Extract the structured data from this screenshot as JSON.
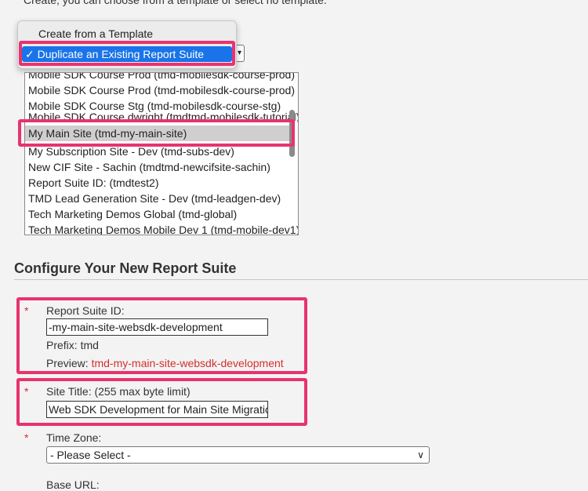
{
  "intro_text": "Create, you can choose from a template or select no template.",
  "template_menu": {
    "options": [
      "Create from a Template",
      "Duplicate an Existing Report Suite"
    ],
    "selected_index": 1,
    "checkmark": "✓"
  },
  "report_suite_list": {
    "items": [
      "Mobile SDK Course Prod (tmd-mobilesdk-course-prod)",
      "Mobile SDK Course Stg (tmd-mobilesdk-course-stg)",
      "Mobile SDK Course dwright (tmdtmd-mobilesdk-tutorial)",
      "My Main Site (tmd-my-main-site)",
      "My Subscription Site - Dev (tmd-subs-dev)",
      "New CIF Site - Sachin (tmdtmd-newcifsite-sachin)",
      "Report Suite ID: (tmdtest2)",
      "TMD Lead Generation Site - Dev (tmd-leadgen-dev)",
      "Tech Marketing Demos Global (tmd-global)",
      "Tech Marketing Demos Mobile Dev 1 (tmd-mobile-dev1)"
    ],
    "selected_index": 3
  },
  "configure": {
    "title": "Configure Your New Report Suite",
    "required_mark": "*",
    "report_suite_id": {
      "label": "Report Suite ID:",
      "value": "-my-main-site-websdk-development",
      "prefix_label": "Prefix: tmd",
      "preview_label": "Preview: ",
      "preview_value": "tmd-my-main-site-websdk-development"
    },
    "site_title": {
      "label": "Site Title: (255 max byte limit)",
      "value": "Web SDK Development for Main Site Migration"
    },
    "time_zone": {
      "label": "Time Zone:",
      "selected": "- Please Select -"
    },
    "base_url": {
      "label": "Base URL:"
    }
  },
  "colors": {
    "highlight": "#e8336e",
    "required": "#d32f2f",
    "menu_selected": "#1a73e8"
  }
}
